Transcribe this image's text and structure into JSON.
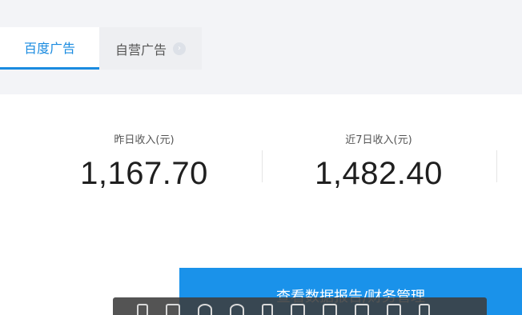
{
  "tabs": {
    "active": "百度广告",
    "inactive": "自营广告",
    "info_icon": "arrow-circle-icon"
  },
  "stats": [
    {
      "label": "昨日收入(元)",
      "value": "1,167.70"
    },
    {
      "label": "近7日收入(元)",
      "value": "1,482.40"
    }
  ],
  "cta": {
    "label": "查看数据报告/财务管理"
  },
  "colors": {
    "accent": "#1a8be0",
    "cta": "#1a92ea",
    "toolbar": "#3c3c3c"
  }
}
